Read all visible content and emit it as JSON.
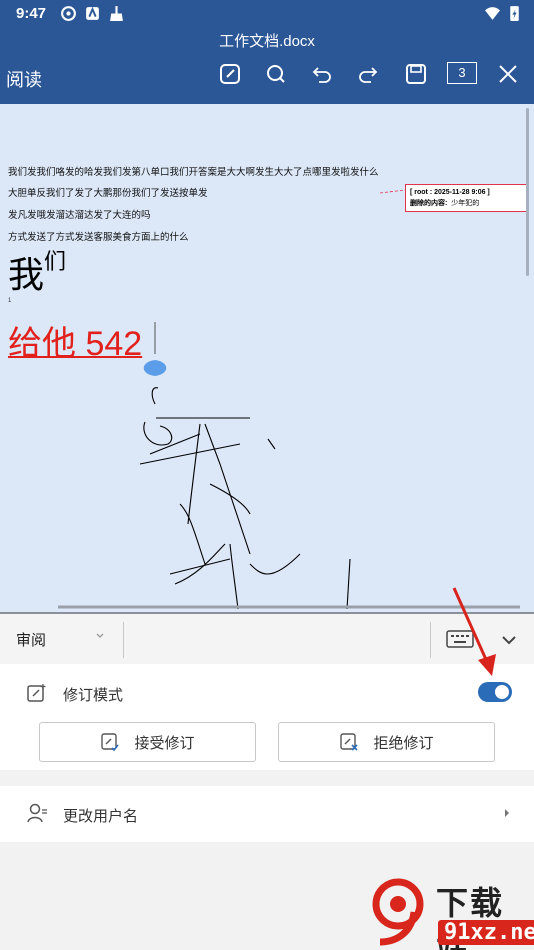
{
  "status": {
    "time": "9:47"
  },
  "header": {
    "title": "工作文档.docx",
    "mode": "阅读",
    "page_count": "3"
  },
  "document": {
    "lines": [
      "我们发我们咯发的哈发我们发第八单口我们开答案是大大啊发生大大了点哪里发啦发什么",
      "大胆单反我们了发了大鹏那份我们了发送按单发",
      "发凡发哦发溜达溜达发了大连的吗",
      "方式发送了方式发送客服美食方面上的什么"
    ],
    "big_text": "我",
    "big_sup": "们",
    "tiny_mark": "1",
    "inserted_text": "给他 542",
    "comment": {
      "header": "[ root : 2025-11-28   9:06 ]",
      "label": "删除的内容:",
      "value": "少年犯的"
    }
  },
  "toolbar": {
    "review_label": "审阅"
  },
  "panel": {
    "track_changes_label": "修订模式",
    "track_changes_on": true,
    "accept_label": "接受修订",
    "reject_label": "拒绝修订"
  },
  "user": {
    "change_username_label": "更改用户名"
  },
  "watermark": {
    "brand": "下载站",
    "site": "91xz.net"
  },
  "colors": {
    "brand": "#2b5797",
    "doc_bg": "#dce7f7",
    "insert_red": "#e2211c",
    "toggle": "#2b6cb8"
  }
}
